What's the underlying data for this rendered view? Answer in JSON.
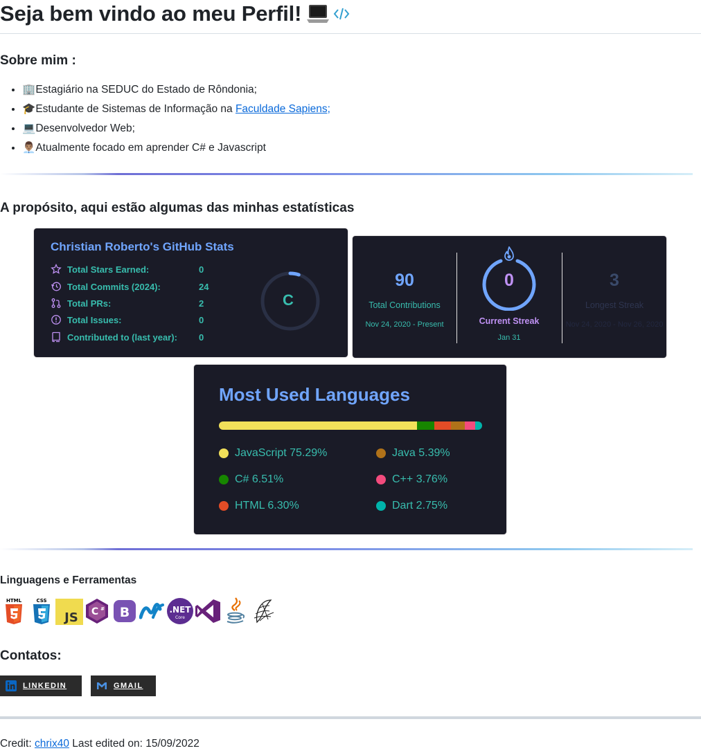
{
  "header": {
    "title": "Seja bem vindo ao meu Perfil!"
  },
  "about": {
    "heading": "Sobre mim :",
    "items": [
      {
        "emoji": "🏢",
        "text": "Estagiário na SEDUC do Estado de Rôndonia;"
      },
      {
        "emoji": "🎓",
        "text": "Estudante de Sistemas de Informação na ",
        "link": "Faculdade Sapiens;"
      },
      {
        "emoji": "💻",
        "text": "Desenvolvedor Web;"
      },
      {
        "emoji": "👨🏽‍💼",
        "text": "Atualmente focado em aprender C# e Javascript"
      }
    ]
  },
  "stats_section": {
    "heading": "A propósito, aqui estão algumas das minhas estatísticas"
  },
  "github_stats": {
    "title": "Christian Roberto's GitHub Stats",
    "rows": [
      {
        "icon": "star-icon",
        "label": "Total Stars Earned:",
        "value": "0"
      },
      {
        "icon": "history-icon",
        "label": "Total Commits (2024):",
        "value": "24"
      },
      {
        "icon": "pull-request-icon",
        "label": "Total PRs:",
        "value": "2"
      },
      {
        "icon": "issue-icon",
        "label": "Total Issues:",
        "value": "0"
      },
      {
        "icon": "repo-icon",
        "label": "Contributed to (last year):",
        "value": "0"
      }
    ],
    "rank": "C",
    "rank_progress": 0.05
  },
  "streak": {
    "total": {
      "value": "90",
      "label": "Total Contributions",
      "range": "Nov 24, 2020 - Present"
    },
    "current": {
      "value": "0",
      "label": "Current Streak",
      "range": "Jan 31"
    },
    "longest": {
      "value": "3",
      "label": "Longest Streak",
      "range": "Nov 24, 2020 - Nov 26, 2020"
    }
  },
  "languages": {
    "title": "Most Used Languages",
    "items": [
      {
        "name": "JavaScript",
        "percent": 75.29,
        "label": "JavaScript 75.29%",
        "color": "#f1e05a"
      },
      {
        "name": "C#",
        "percent": 6.51,
        "label": "C# 6.51%",
        "color": "#178600"
      },
      {
        "name": "HTML",
        "percent": 6.3,
        "label": "HTML 6.30%",
        "color": "#e34c26"
      },
      {
        "name": "Java",
        "percent": 5.39,
        "label": "Java 5.39%",
        "color": "#b07219"
      },
      {
        "name": "C++",
        "percent": 3.76,
        "label": "C++ 3.76%",
        "color": "#f34b7d"
      },
      {
        "name": "Dart",
        "percent": 2.75,
        "label": "Dart 2.75%",
        "color": "#00b4ab"
      }
    ]
  },
  "tools": {
    "heading": "Linguagens e Ferramentas",
    "icons": [
      "html5-icon",
      "css3-icon",
      "javascript-icon",
      "csharp-icon",
      "bootstrap-icon",
      "dotnet-icon",
      "dotnet-core-icon",
      "visual-studio-icon",
      "java-icon",
      "sql-server-icon"
    ]
  },
  "contacts": {
    "heading": "Contatos:",
    "linkedin": "LINKEDIN",
    "gmail": "GMAIL"
  },
  "footer": {
    "credit_prefix": "Credit:",
    "credit_link": "chrix40",
    "edited": "Last edited on: 15/09/2022"
  },
  "colors": {
    "card_bg": "#1a1b27",
    "card_title": "#70a5fd",
    "card_text": "#38bdae",
    "link": "#0969da"
  }
}
